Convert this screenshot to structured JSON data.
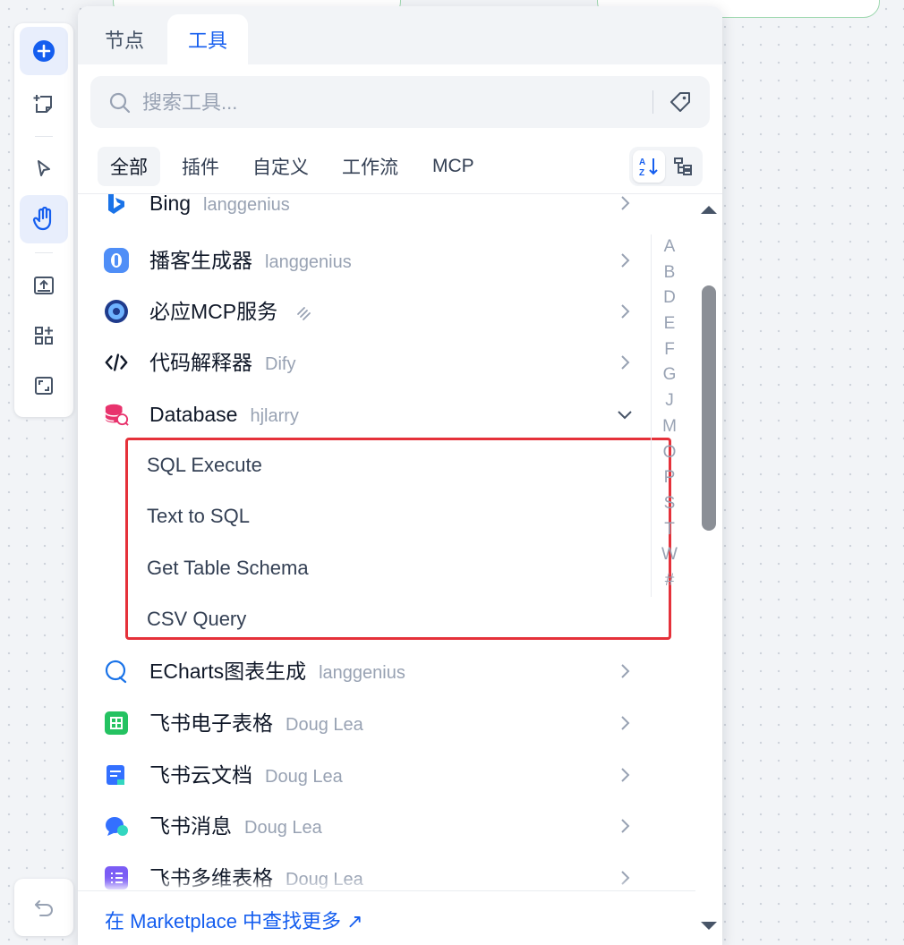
{
  "panel": {
    "tabs": [
      {
        "label": "节点",
        "active": false
      },
      {
        "label": "工具",
        "active": true
      }
    ],
    "search": {
      "placeholder": "搜索工具...",
      "value": ""
    },
    "filters": [
      "全部",
      "插件",
      "自定义",
      "工作流",
      "MCP"
    ],
    "active_filter": "全部",
    "view_modes": {
      "sort_icon": "sort-az-icon",
      "tree_icon": "tree-view-icon",
      "active": "sort"
    },
    "alphabet": [
      "A",
      "B",
      "D",
      "E",
      "F",
      "G",
      "J",
      "M",
      "O",
      "P",
      "S",
      "T",
      "W",
      "#"
    ],
    "tools": [
      {
        "name": "Bing",
        "author": "langgenius",
        "icon": "bing-icon",
        "expanded": false
      },
      {
        "name": "播客生成器",
        "author": "langgenius",
        "icon": "podcast-icon",
        "expanded": false
      },
      {
        "name": "必应MCP服务",
        "author": "",
        "icon": "mcp-service-icon",
        "expanded": false
      },
      {
        "name": "代码解释器",
        "author": "Dify",
        "icon": "code-icon",
        "expanded": false
      },
      {
        "name": "Database",
        "author": "hjlarry",
        "icon": "database-icon",
        "expanded": true,
        "actions": [
          "SQL Execute",
          "Text to SQL",
          "Get Table Schema",
          "CSV Query"
        ]
      },
      {
        "name": "ECharts图表生成",
        "author": "langgenius",
        "icon": "echarts-icon",
        "expanded": false
      },
      {
        "name": "飞书电子表格",
        "author": "Doug Lea",
        "icon": "feishu-sheet-icon",
        "expanded": false
      },
      {
        "name": "飞书云文档",
        "author": "Doug Lea",
        "icon": "feishu-doc-icon",
        "expanded": false
      },
      {
        "name": "飞书消息",
        "author": "Doug Lea",
        "icon": "feishu-message-icon",
        "expanded": false
      },
      {
        "name": "飞书多维表格",
        "author": "Doug Lea",
        "icon": "feishu-bitable-icon",
        "expanded": false
      }
    ],
    "footer_link": "在 Marketplace 中查找更多 ↗"
  },
  "toolbar": {
    "items": [
      "add-icon",
      "add-note-icon",
      "pointer-icon",
      "hand-icon",
      "export-icon",
      "organize-icon",
      "maximize-icon"
    ],
    "active": "hand-icon",
    "undo_icon": "undo-icon"
  },
  "colors": {
    "accent": "#155eef",
    "highlight_border": "#e5313a",
    "muted_text": "#98a2b3"
  }
}
